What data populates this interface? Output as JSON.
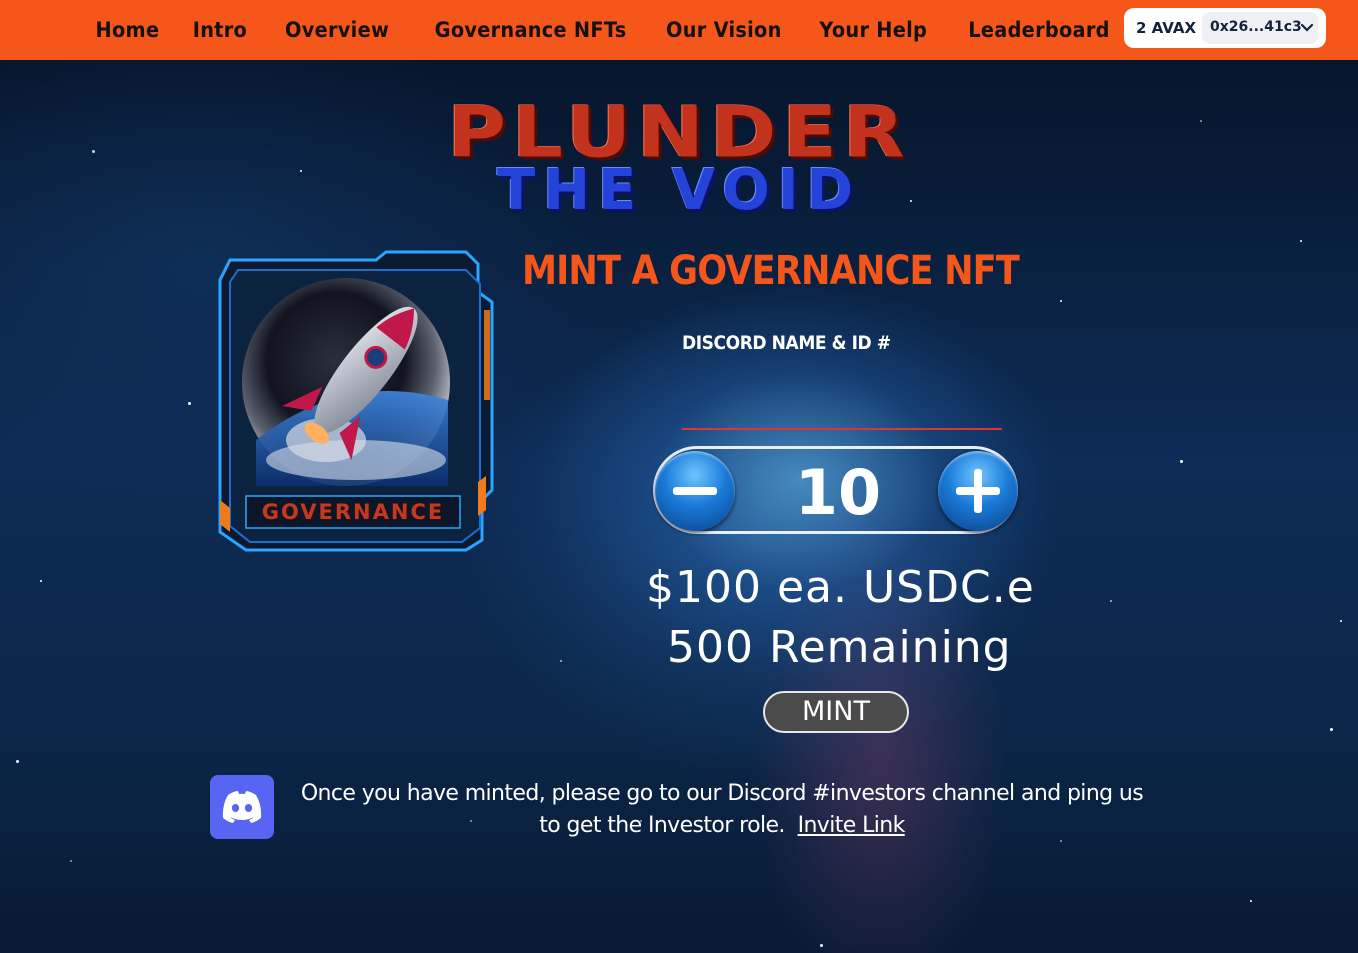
{
  "nav": {
    "links": [
      "Home",
      "Intro",
      "Overview",
      "Governance NFTs",
      "Our Vision",
      "Your Help",
      "Leaderboard"
    ],
    "wallet_balance": "2 AVAX",
    "wallet_address": "0x26...41c3"
  },
  "logo": {
    "line1": "PLUNDER",
    "line2": "THE VOID"
  },
  "nft_card": {
    "label": "GOVERNANCE"
  },
  "mint": {
    "title": "MINT A GOVERNANCE NFT",
    "discord_label": "DISCORD NAME & ID #",
    "discord_value": "",
    "quantity": "10",
    "price": "$100 ea. USDC.e",
    "remaining": "500 Remaining",
    "button": "MINT"
  },
  "footer": {
    "note": "Once you have minted, please go to our Discord #investors channel and ping us to get the Investor role.",
    "link": "Invite Link"
  },
  "colors": {
    "accent": "#f5561a",
    "discord": "#5865f2",
    "stepper_blue": "#1a7ad8"
  }
}
